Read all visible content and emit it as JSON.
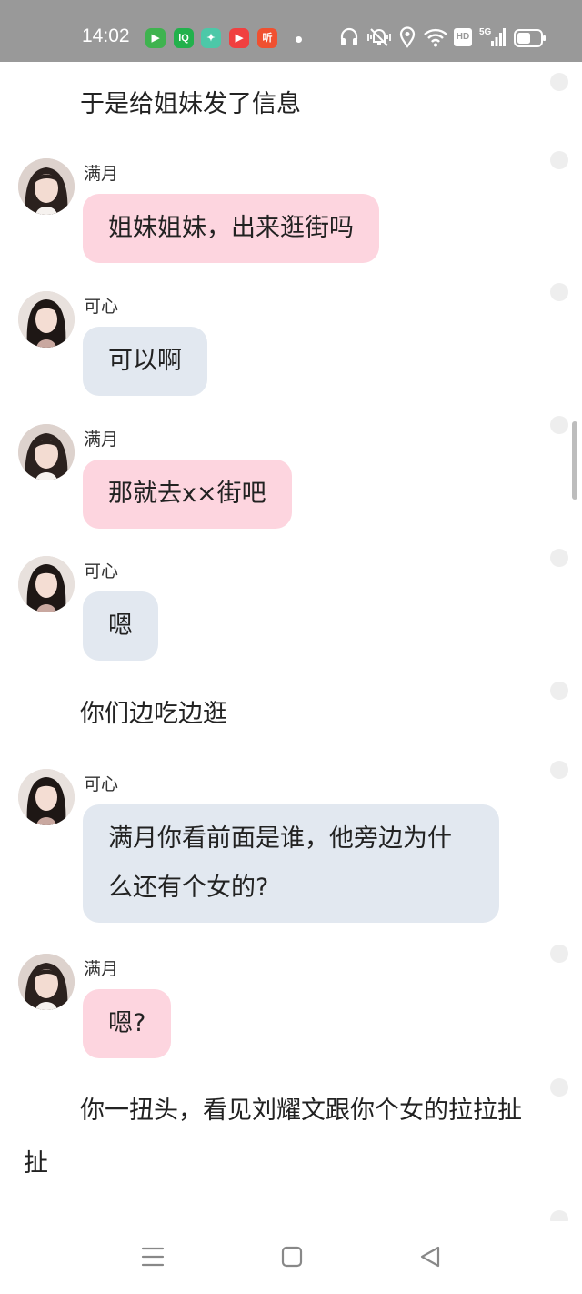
{
  "status_bar": {
    "time": "14:02",
    "app_icons": [
      {
        "name": "tencent-video-icon",
        "color": "#3fb34f",
        "glyph": "▶"
      },
      {
        "name": "iqiyi-icon",
        "color": "#22b14c",
        "glyph": "iQ"
      },
      {
        "name": "app-green-icon",
        "color": "#4cc8a8",
        "glyph": "✦"
      },
      {
        "name": "video-play-icon",
        "color": "#f04040",
        "glyph": "▶"
      },
      {
        "name": "listen-app-icon",
        "color": "#f05030",
        "glyph": "听"
      }
    ],
    "network_label": "5G",
    "hd_label": "HD"
  },
  "colors": {
    "status_bar_bg": "#999999",
    "bubble_pink": "#fdd5df",
    "bubble_gray": "#e2e8f0"
  },
  "chat": {
    "narration_1": "于是给姐妹发了信息",
    "messages": [
      {
        "sender": "满月",
        "text": "姐妹姐妹，出来逛街吗",
        "style": "pink"
      },
      {
        "sender": "可心",
        "text": "可以啊",
        "style": "gray"
      },
      {
        "sender": "满月",
        "text": "那就去x×街吧",
        "style": "pink"
      },
      {
        "sender": "可心",
        "text": "嗯",
        "style": "gray"
      }
    ],
    "narration_2": "你们边吃边逛",
    "messages_2": [
      {
        "sender": "可心",
        "text": "满月你看前面是谁，他旁边为什么还有个女的?",
        "style": "gray"
      },
      {
        "sender": "满月",
        "text": "嗯?",
        "style": "pink"
      }
    ],
    "narration_3": "你一扭头，看见刘耀文跟你个女的拉拉扯扯"
  },
  "nav_bar": {
    "icons": [
      "menu-icon",
      "home-square-icon",
      "back-triangle-icon"
    ]
  }
}
